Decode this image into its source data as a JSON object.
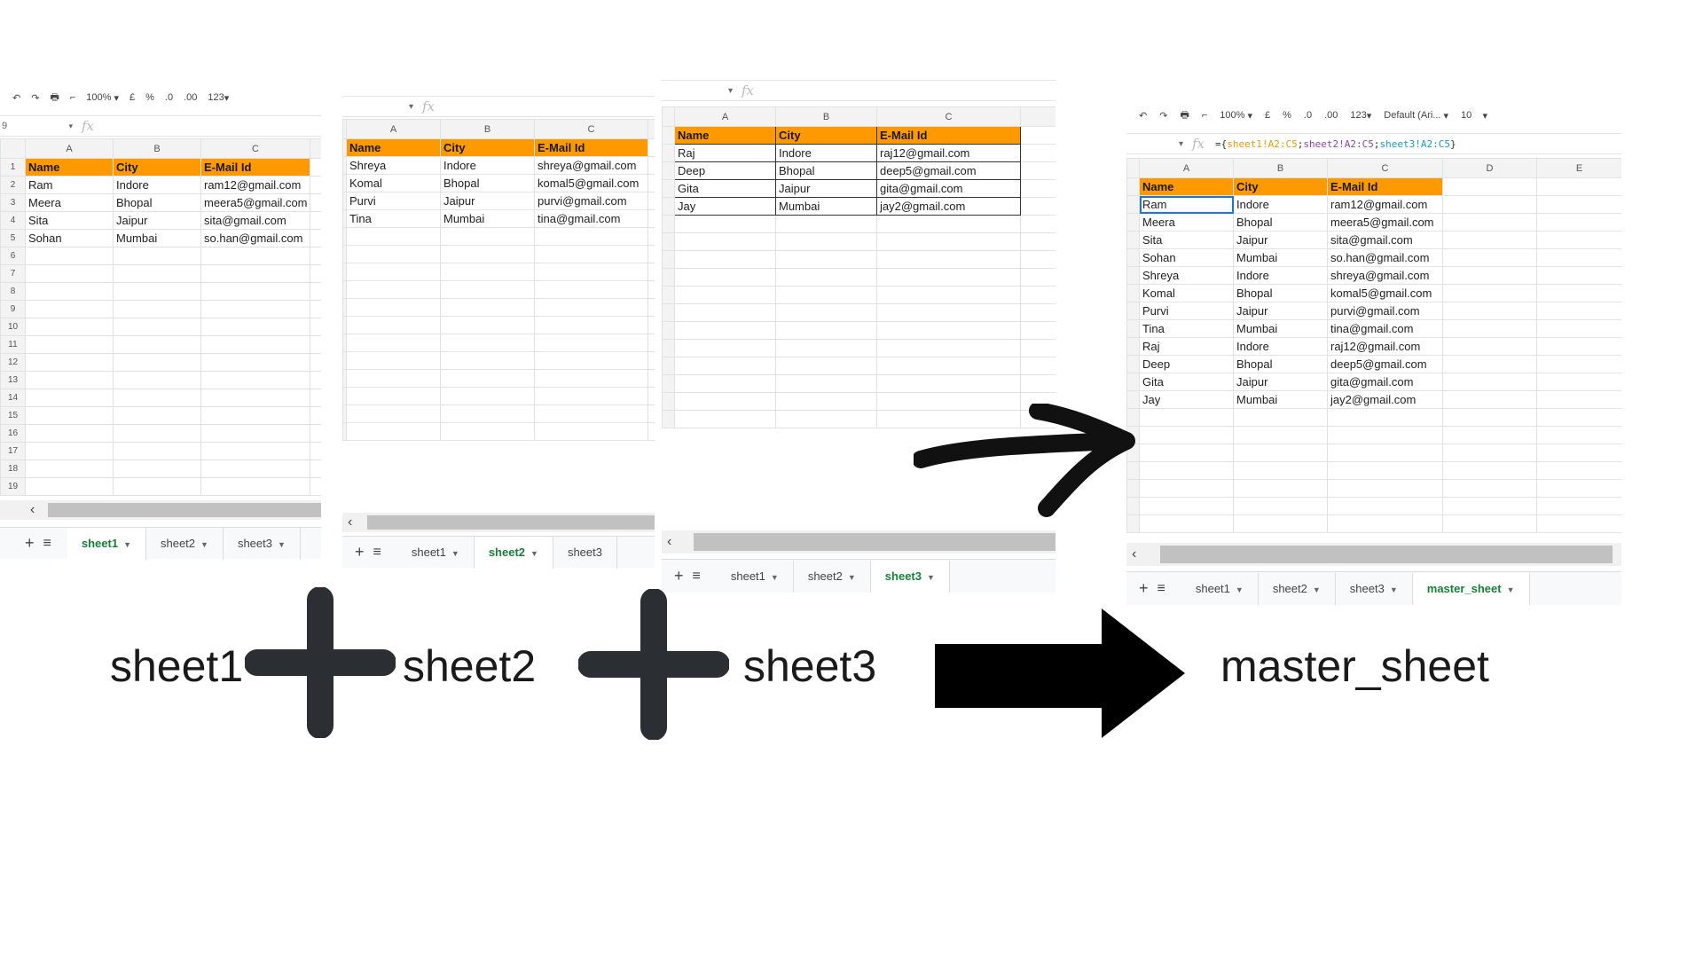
{
  "toolbar": {
    "zoom": "100%",
    "currency": "£",
    "percent": "%",
    "dec_decrease": ".0",
    "dec_increase": ".00",
    "format": "123",
    "font": "Default (Ari...",
    "font_size": "10"
  },
  "formula_bar": {
    "fx": "fx",
    "cell_ref": "9",
    "formula_prefix": "={",
    "formula_sheet1": "sheet1!A2:C5",
    "formula_sep1": ";",
    "formula_sheet2": "sheet2!A2:C5",
    "formula_sep2": ";",
    "formula_sheet3": "sheet3!A2:C5",
    "formula_suffix": "}"
  },
  "columns": [
    "A",
    "B",
    "C",
    "D",
    "E"
  ],
  "headers": [
    "Name",
    "City",
    "E-Mail Id"
  ],
  "sheet1_rows": [
    [
      "Ram",
      "Indore",
      "ram12@gmail.com"
    ],
    [
      "Meera",
      "Bhopal",
      "meera5@gmail.com"
    ],
    [
      "Sita",
      "Jaipur",
      "sita@gmail.com"
    ],
    [
      "Sohan",
      "Mumbai",
      "so.han@gmail.com"
    ]
  ],
  "sheet2_rows": [
    [
      "Shreya",
      "Indore",
      "shreya@gmail.com"
    ],
    [
      "Komal",
      "Bhopal",
      "komal5@gmail.com"
    ],
    [
      "Purvi",
      "Jaipur",
      "purvi@gmail.com"
    ],
    [
      "Tina",
      "Mumbai",
      "tina@gmail.com"
    ]
  ],
  "sheet3_rows": [
    [
      "Raj",
      "Indore",
      "raj12@gmail.com"
    ],
    [
      "Deep",
      "Bhopal",
      "deep5@gmail.com"
    ],
    [
      "Gita",
      "Jaipur",
      "gita@gmail.com"
    ],
    [
      "Jay",
      "Mumbai",
      "jay2@gmail.com"
    ]
  ],
  "master_rows": [
    [
      "Ram",
      "Indore",
      "ram12@gmail.com"
    ],
    [
      "Meera",
      "Bhopal",
      "meera5@gmail.com"
    ],
    [
      "Sita",
      "Jaipur",
      "sita@gmail.com"
    ],
    [
      "Sohan",
      "Mumbai",
      "so.han@gmail.com"
    ],
    [
      "Shreya",
      "Indore",
      "shreya@gmail.com"
    ],
    [
      "Komal",
      "Bhopal",
      "komal5@gmail.com"
    ],
    [
      "Purvi",
      "Jaipur",
      "purvi@gmail.com"
    ],
    [
      "Tina",
      "Mumbai",
      "tina@gmail.com"
    ],
    [
      "Raj",
      "Indore",
      "raj12@gmail.com"
    ],
    [
      "Deep",
      "Bhopal",
      "deep5@gmail.com"
    ],
    [
      "Gita",
      "Jaipur",
      "gita@gmail.com"
    ],
    [
      "Jay",
      "Mumbai",
      "jay2@gmail.com"
    ]
  ],
  "row_numbers": [
    "1",
    "2",
    "3",
    "4",
    "5",
    "6",
    "7",
    "8",
    "9",
    "10",
    "11",
    "12",
    "13",
    "14",
    "15",
    "16",
    "17",
    "18",
    "19"
  ],
  "tabs": {
    "sheet1": "sheet1",
    "sheet2": "sheet2",
    "sheet3": "sheet3",
    "master": "master_sheet"
  },
  "labels": {
    "sheet1": "sheet1",
    "sheet2": "sheet2",
    "sheet3": "sheet3",
    "master": "master_sheet"
  },
  "colors": {
    "header_fill": "#ff9900",
    "active_tab": "#188038",
    "icon_dark": "#2b2f33"
  }
}
